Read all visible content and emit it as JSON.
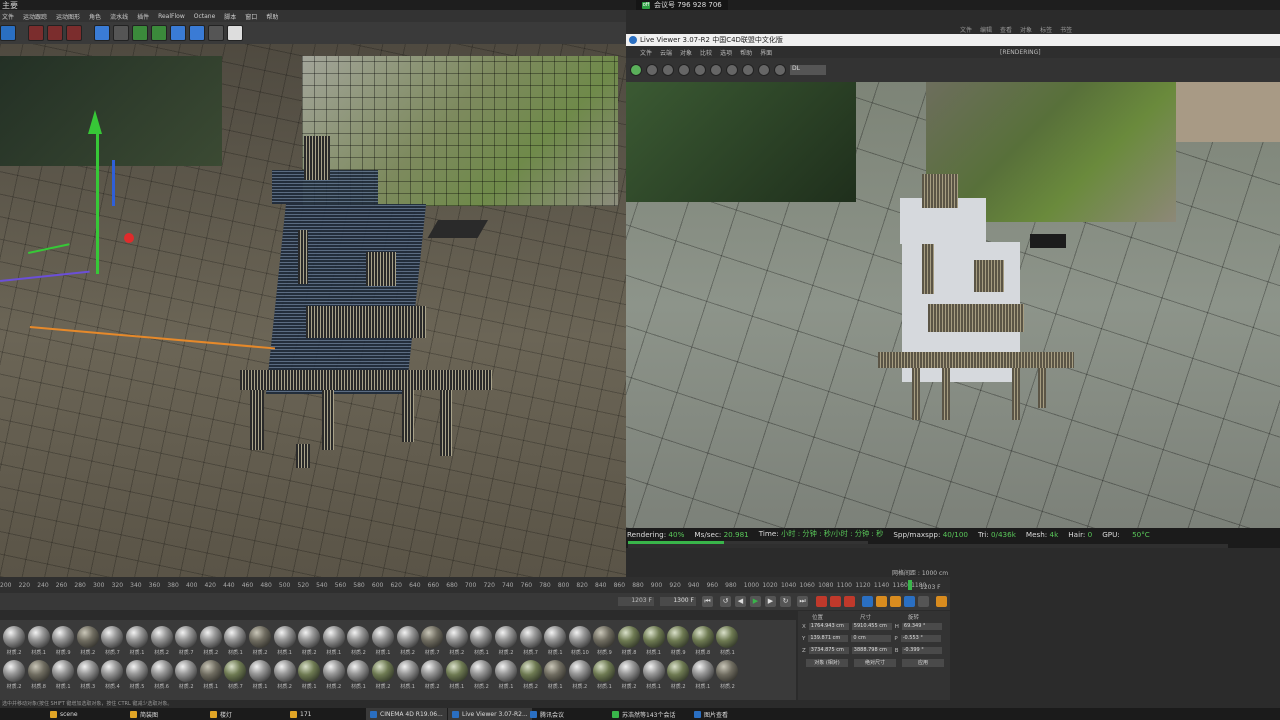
{
  "window": {
    "title": "主要",
    "meeting": {
      "badge": "off",
      "label": "会议号 796 928 706"
    }
  },
  "c4d_menu": [
    "文件",
    "运动跟踪",
    "运动图形",
    "角色",
    "流水线",
    "插件",
    "RealFlow",
    "Octane",
    "脚本",
    "窗口",
    "帮助"
  ],
  "right_menu": [
    "文件",
    "编辑",
    "查看",
    "对象",
    "标签",
    "书签"
  ],
  "live_viewer": {
    "title": "Live Viewer 3.07-R2 中国C4D联盟中文化版",
    "menu": [
      "文件",
      "云端",
      "对象",
      "比较",
      "选项",
      "帮助",
      "界面"
    ],
    "rendering_label": "[RENDERING]",
    "camera_select": "DL",
    "status": {
      "rendering": "40%",
      "ms_sec": "20.981",
      "time": "小时 : 分钟 : 秒/小时 : 分钟 : 秒",
      "spp": "40/100",
      "tri": "0/436k",
      "mesh": "4k",
      "hair": "0",
      "gpu": "50°C",
      "progress": 0.4
    }
  },
  "timeline": {
    "ticks": [
      "200",
      "220",
      "240",
      "260",
      "280",
      "300",
      "320",
      "340",
      "360",
      "380",
      "400",
      "420",
      "440",
      "460",
      "480",
      "500",
      "520",
      "540",
      "560",
      "580",
      "600",
      "620",
      "640",
      "660",
      "680",
      "700",
      "720",
      "740",
      "760",
      "780",
      "800",
      "820",
      "840",
      "860",
      "880",
      "900",
      "920",
      "940",
      "960",
      "980",
      "1000",
      "1020",
      "1040",
      "1060",
      "1080",
      "1100",
      "1120",
      "1140",
      "1160",
      "1180"
    ],
    "grid_label": "网格间距 : 1000 cm",
    "end_frame_label": "1203 F",
    "frame_current": "1203 F",
    "frame_end": "1300 F"
  },
  "materials": [
    "材质.2",
    "材质.1",
    "材质.9",
    "材质.2",
    "材质.7",
    "材质.1",
    "材质.2",
    "材质.7",
    "材质.2",
    "材质.1",
    "材质.2",
    "材质.1",
    "材质.2",
    "材质.1",
    "材质.2",
    "材质.1",
    "材质.2",
    "材质.7",
    "材质.2",
    "材质.1",
    "材质.2",
    "材质.7",
    "材质.1",
    "材质.10",
    "材质.9",
    "材质.8",
    "材质.1",
    "材质.9",
    "材质.8",
    "材质.1",
    "材质.2",
    "材质.8",
    "材质.1",
    "材质.3",
    "材质.4",
    "材质.5",
    "材质.6",
    "材质.2",
    "材质.1",
    "材质.7",
    "材质.1",
    "材质.2",
    "材质.1",
    "材质.2",
    "材质.1",
    "材质.2",
    "材质.1",
    "材质.2",
    "材质.1",
    "材质.2",
    "材质.1",
    "材质.2",
    "材质.1",
    "材质.2",
    "材质.1",
    "材质.2",
    "材质.1",
    "材质.2",
    "材质.1",
    "材质.2"
  ],
  "coords": {
    "header": [
      "位置",
      "尺寸",
      "旋转"
    ],
    "rows": [
      {
        "axis": "X",
        "pos": "1764.943 cm",
        "size": "5910.455 cm",
        "rot_axis": "H",
        "rot": "69.349 °"
      },
      {
        "axis": "Y",
        "pos": "139.871 cm",
        "size": "0 cm",
        "rot_axis": "P",
        "rot": "-0.553 °"
      },
      {
        "axis": "Z",
        "pos": "3734.875 cm",
        "size": "3888.798 cm",
        "rot_axis": "B",
        "rot": "-0.399 °"
      }
    ],
    "mode_a": "对象 (相对)",
    "mode_b": "绝对尺寸",
    "apply": "应用"
  },
  "status_line": "选中并移动对象(按住 SHIFT 键增加选取对象，按住 CTRL 键减少选取对象。",
  "taskbar": [
    {
      "label": "scene",
      "icon": "folder-icon"
    },
    {
      "label": "简装图",
      "icon": "folder-icon"
    },
    {
      "label": "楼灯",
      "icon": "folder-icon"
    },
    {
      "label": "171",
      "icon": "folder-icon"
    },
    {
      "label": "CINEMA 4D R19.06...",
      "icon": "cinema4d-icon"
    },
    {
      "label": "Live Viewer 3.07-R2...",
      "icon": "live-viewer-icon"
    },
    {
      "label": "腾讯会议",
      "icon": "meeting-icon"
    },
    {
      "label": "苏浩然等143个会话",
      "icon": "chat-icon"
    },
    {
      "label": "图片查看",
      "icon": "image-viewer-icon"
    }
  ]
}
